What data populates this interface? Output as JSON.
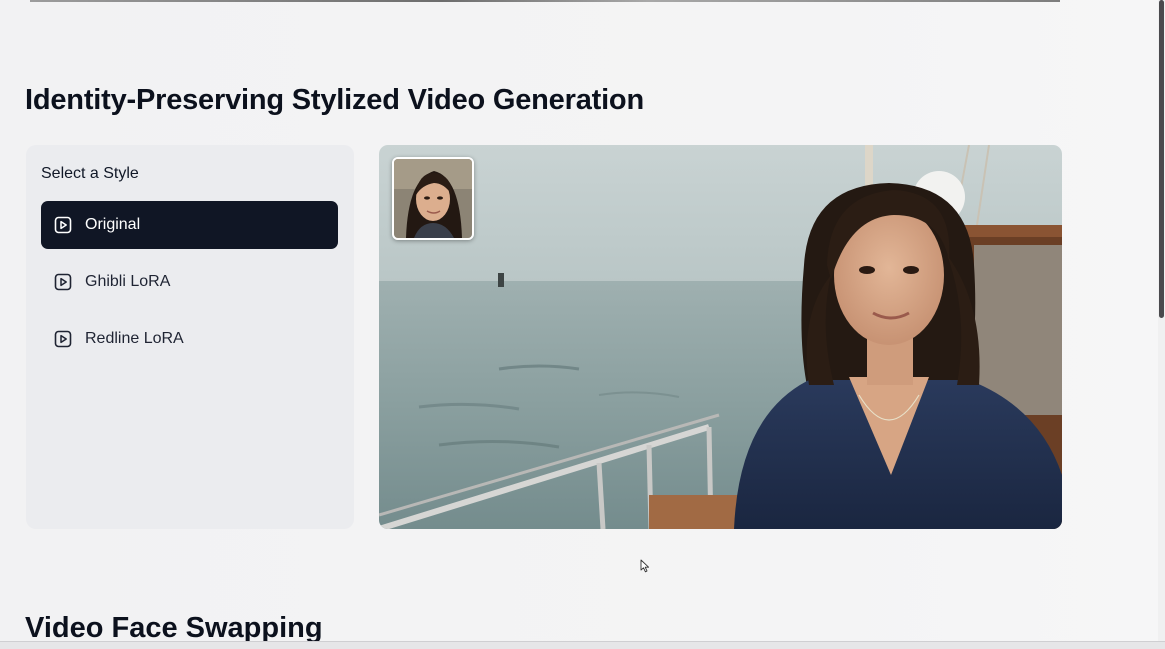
{
  "section": {
    "title": "Identity-Preserving Stylized Video Generation"
  },
  "style_panel": {
    "heading": "Select a Style",
    "options": [
      {
        "label": "Original",
        "icon": "play-square-icon",
        "selected": true
      },
      {
        "label": "Ghibli LoRA",
        "icon": "play-square-icon",
        "selected": false
      },
      {
        "label": "Redline LoRA",
        "icon": "play-square-icon",
        "selected": false
      }
    ]
  },
  "next_section": {
    "title": "Video Face Swapping"
  },
  "colors": {
    "active_option_bg": "#101625",
    "panel_bg": "#ebecef",
    "page_bg": "#f3f3f4"
  }
}
